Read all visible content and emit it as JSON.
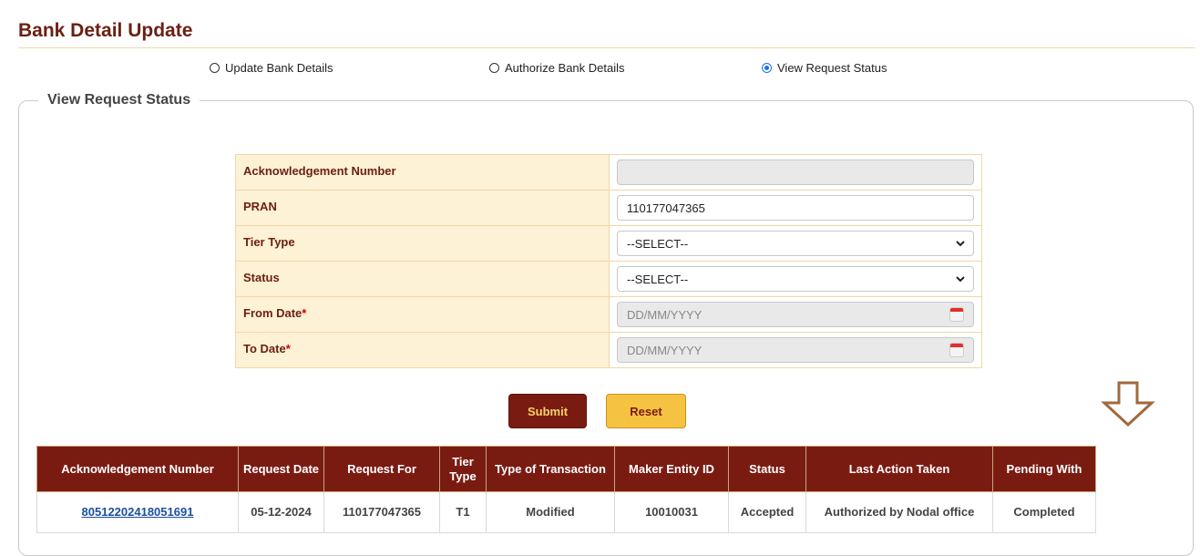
{
  "page": {
    "title": "Bank Detail Update"
  },
  "options": [
    {
      "label": "Update Bank Details",
      "checked": false
    },
    {
      "label": "Authorize Bank Details",
      "checked": false
    },
    {
      "label": "View Request Status",
      "checked": true
    }
  ],
  "section": {
    "legend": "View Request Status"
  },
  "form": {
    "ack_label": "Acknowledgement Number",
    "ack_value": "",
    "pran_label": "PRAN",
    "pran_value": "110177047365",
    "tier_label": "Tier Type",
    "tier_value": "--SELECT--",
    "status_label": "Status",
    "status_value": "--SELECT--",
    "from_label": "From Date",
    "from_placeholder": "DD/MM/YYYY",
    "to_label": "To Date",
    "to_placeholder": "DD/MM/YYYY",
    "required_mark": "*"
  },
  "buttons": {
    "submit": "Submit",
    "reset": "Reset"
  },
  "table": {
    "headers": [
      "Acknowledgement Number",
      "Request Date",
      "Request For",
      "Tier Type",
      "Type of Transaction",
      "Maker Entity ID",
      "Status",
      "Last Action Taken",
      "Pending With"
    ],
    "rows": [
      [
        "80512202418051691",
        "05-12-2024",
        "110177047365",
        "T1",
        "Modified",
        "10010031",
        "Accepted",
        "Authorized by Nodal office",
        "Completed"
      ]
    ]
  },
  "colors": {
    "header_bg": "#7a1b12",
    "accent_gold": "#f5c242",
    "label_bg": "#fdf1d6",
    "arrow": "#a06a3e"
  }
}
